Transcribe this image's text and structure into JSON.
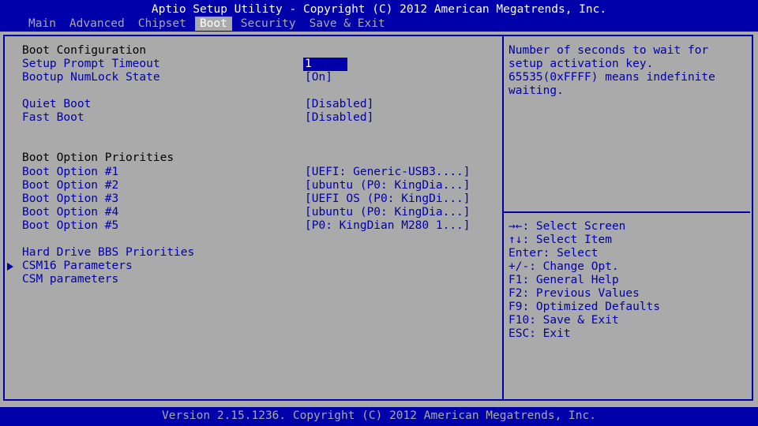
{
  "header": {
    "title": "Aptio Setup Utility - Copyright (C) 2012 American Megatrends, Inc.",
    "tabs": [
      "Main",
      "Advanced",
      "Chipset",
      "Boot",
      "Security",
      "Save & Exit"
    ],
    "active_tab": "Boot"
  },
  "settings": {
    "boot_configuration": "Boot Configuration",
    "setup_prompt_timeout": {
      "label": "Setup Prompt Timeout",
      "value": "1"
    },
    "bootup_numlock": {
      "label": "Bootup NumLock State",
      "value": "[On]"
    },
    "quiet_boot": {
      "label": "Quiet Boot",
      "value": "[Disabled]"
    },
    "fast_boot": {
      "label": "Fast Boot",
      "value": "[Disabled]"
    },
    "boot_option_priorities": "Boot Option Priorities",
    "boot_options": [
      {
        "label": "Boot Option #1",
        "value": "[UEFI: Generic-USB3....]"
      },
      {
        "label": "Boot Option #2",
        "value": "[ubuntu (P0: KingDia...]"
      },
      {
        "label": "Boot Option #3",
        "value": "[UEFI OS (P0: KingDi...]"
      },
      {
        "label": "Boot Option #4",
        "value": "[ubuntu (P0: KingDia...]"
      },
      {
        "label": "Boot Option #5",
        "value": "[P0: KingDian M280 1...]"
      }
    ],
    "hard_drive_bbs": "Hard Drive BBS Priorities",
    "csm16_parameters": "CSM16 Parameters",
    "csm_parameters": "CSM parameters"
  },
  "help": {
    "lines": [
      "Number of seconds to wait for",
      "setup activation key.",
      "65535(0xFFFF) means indefinite",
      "waiting."
    ]
  },
  "keys": [
    "→←: Select Screen",
    "↑↓: Select Item",
    "Enter: Select",
    "+/-: Change Opt.",
    "F1: General Help",
    "F2: Previous Values",
    "F9: Optimized Defaults",
    "F10: Save & Exit",
    "ESC: Exit"
  ],
  "footer": {
    "text": "Version 2.15.1236. Copyright (C) 2012 American Megatrends, Inc."
  },
  "colors": {
    "background": "#aaaaaa",
    "accent": "#0000aa",
    "header_text": "#ffffff"
  }
}
